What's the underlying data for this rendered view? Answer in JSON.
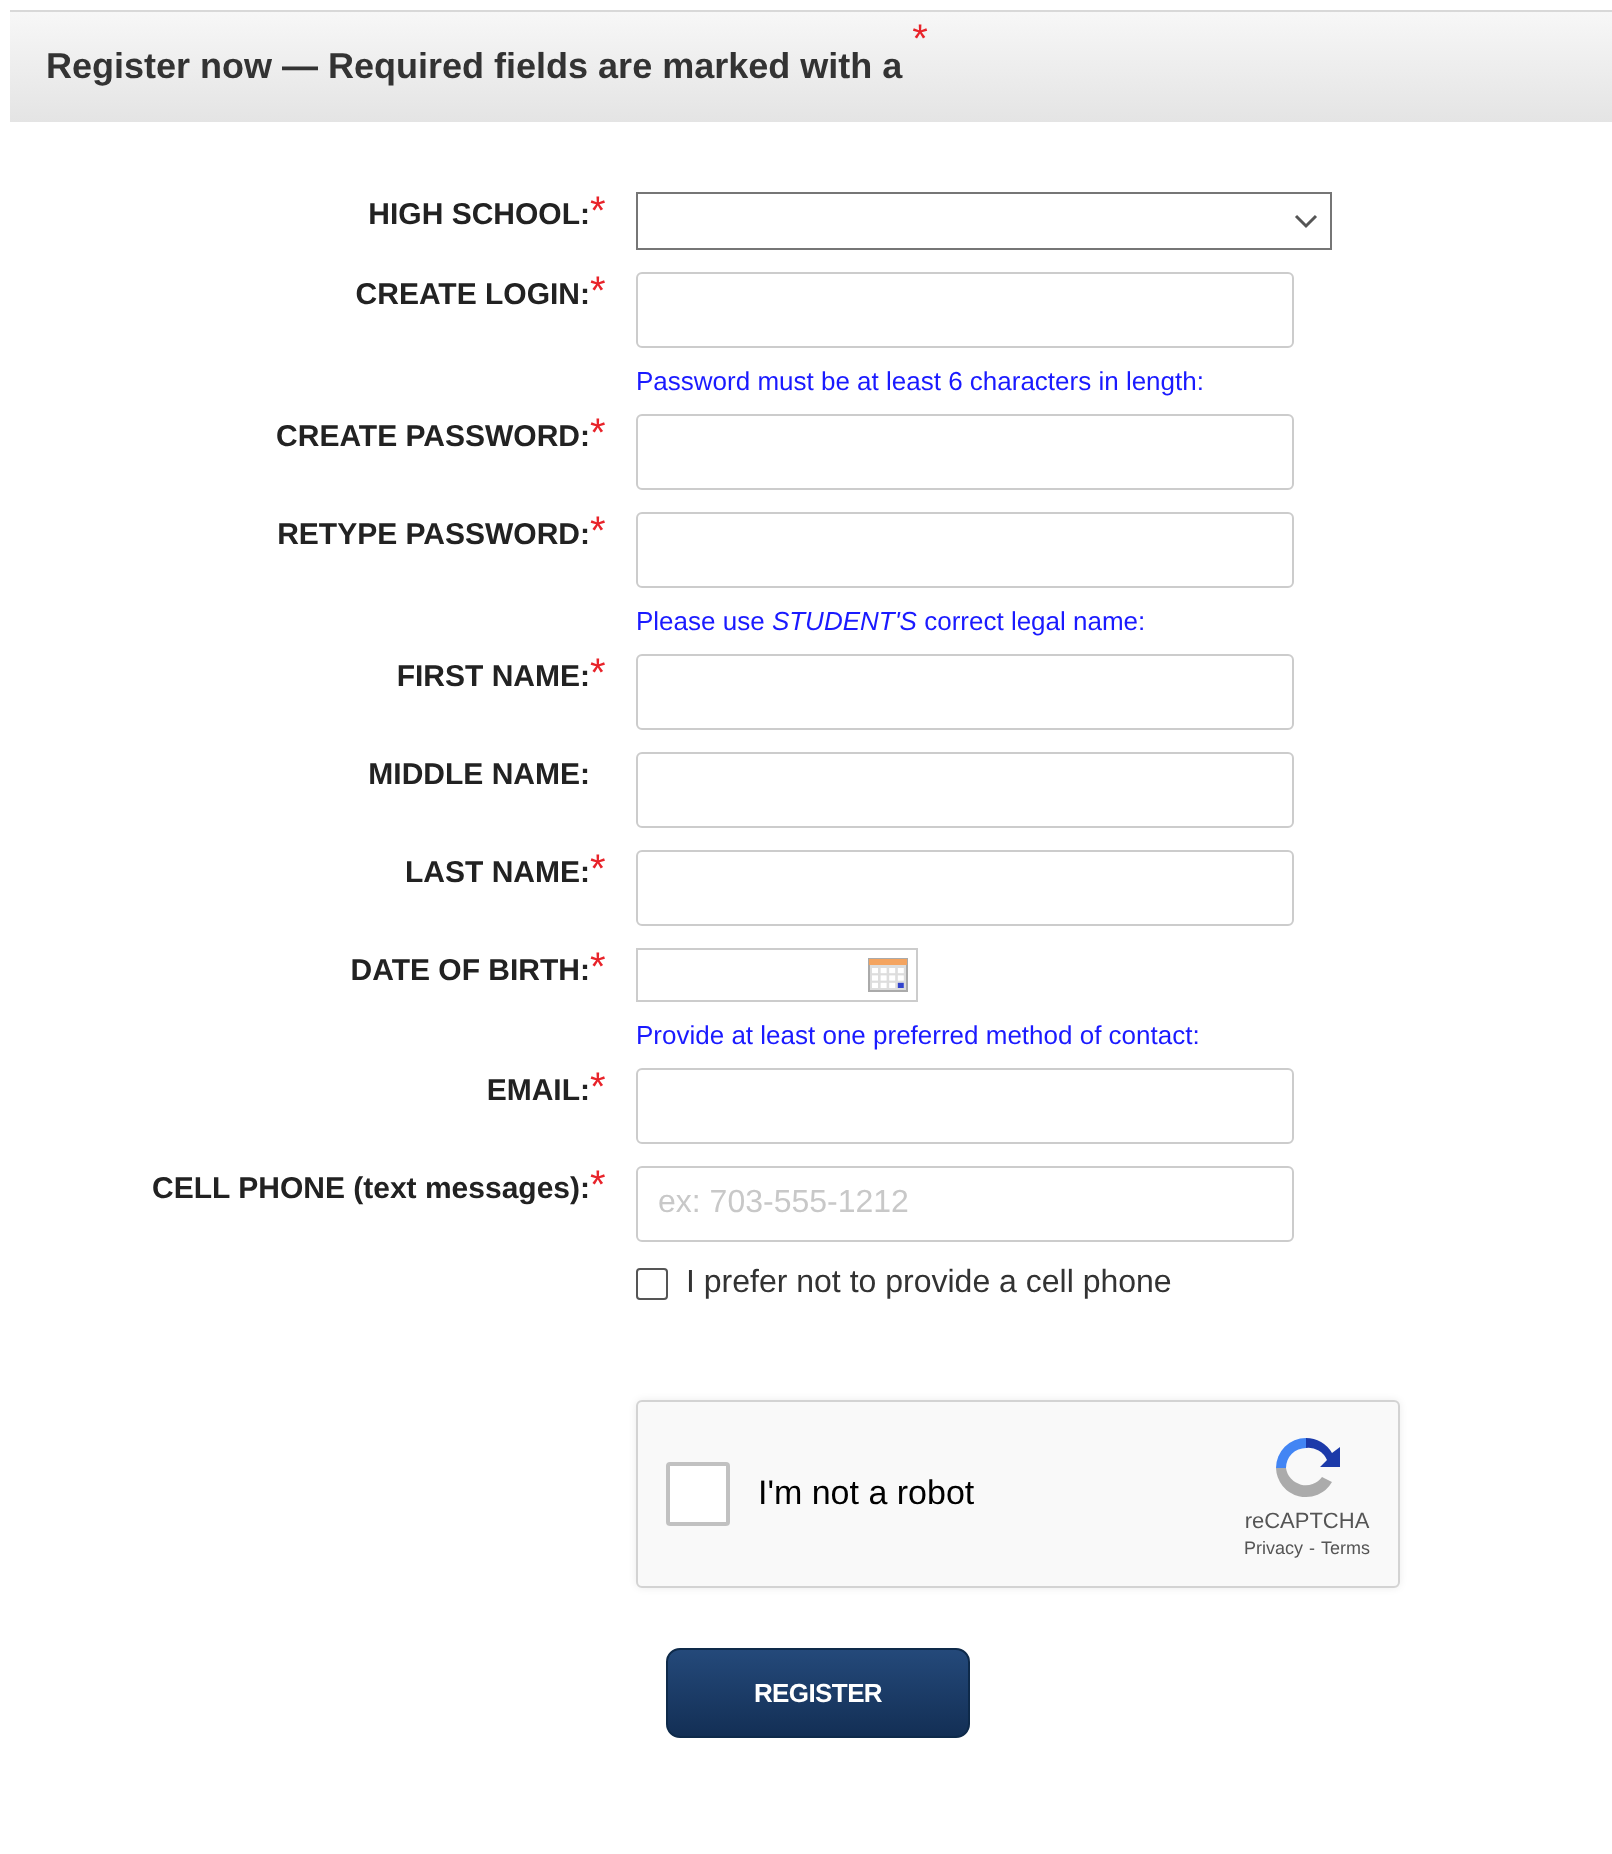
{
  "header": {
    "title": "Register now — Required fields are marked with a",
    "marker": "*"
  },
  "rows": [
    {
      "kind": "select",
      "label": "HIGH SCHOOL:",
      "marker": "*"
    },
    {
      "kind": "text",
      "label": "CREATE LOGIN:",
      "marker": "*"
    },
    {
      "kind": "note",
      "text": "Password must be at least 6 characters in length:"
    },
    {
      "kind": "text",
      "label": "CREATE PASSWORD:",
      "marker": "*"
    },
    {
      "kind": "text",
      "label": "RETYPE PASSWORD:",
      "marker": "*"
    },
    {
      "kind": "note",
      "text": "Please use *STUDENT'S* correct legal name:"
    },
    {
      "kind": "text",
      "label": "FIRST NAME:",
      "marker": "*"
    },
    {
      "kind": "text",
      "label": "MIDDLE NAME:"
    },
    {
      "kind": "text",
      "label": "LAST NAME:",
      "marker": "*"
    },
    {
      "kind": "date",
      "label": "DATE OF BIRTH:",
      "marker": "*"
    },
    {
      "kind": "note",
      "text": "Provide at least one preferred method of contact:"
    },
    {
      "kind": "text",
      "label": "EMAIL:",
      "marker": "*"
    },
    {
      "kind": "text",
      "label": "CELL PHONE (text messages):",
      "marker": "*",
      "placeholder": "ex: 703-555-1212"
    },
    {
      "kind": "checkbox",
      "text": "I prefer not to provide a cell phone",
      "checked": false
    }
  ],
  "captcha": {
    "text": "I'm not a robot",
    "checked": false,
    "brand": "reCAPTCHA",
    "links": [
      "Privacy",
      "Terms"
    ],
    "separator": "-"
  },
  "submit": "REGISTER"
}
